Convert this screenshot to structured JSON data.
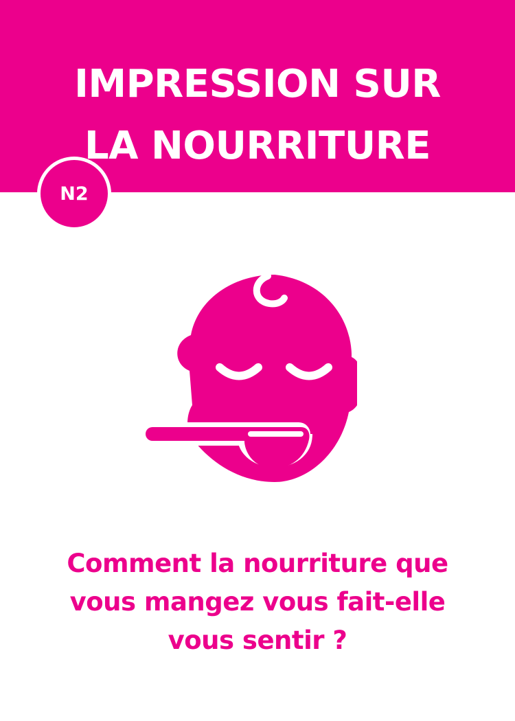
{
  "header": {
    "title_lines": [
      "IMPRESSION SUR",
      "LA NOURRITURE"
    ],
    "badge": "N2"
  },
  "illustration": {
    "icon": "baby-tasting-spoon-icon"
  },
  "question": {
    "lines": [
      "Comment la nourriture que",
      "vous mangez vous fait-elle",
      "vous sentir ?"
    ]
  },
  "colors": {
    "accent": "#ec008c",
    "background": "#ffffff"
  }
}
